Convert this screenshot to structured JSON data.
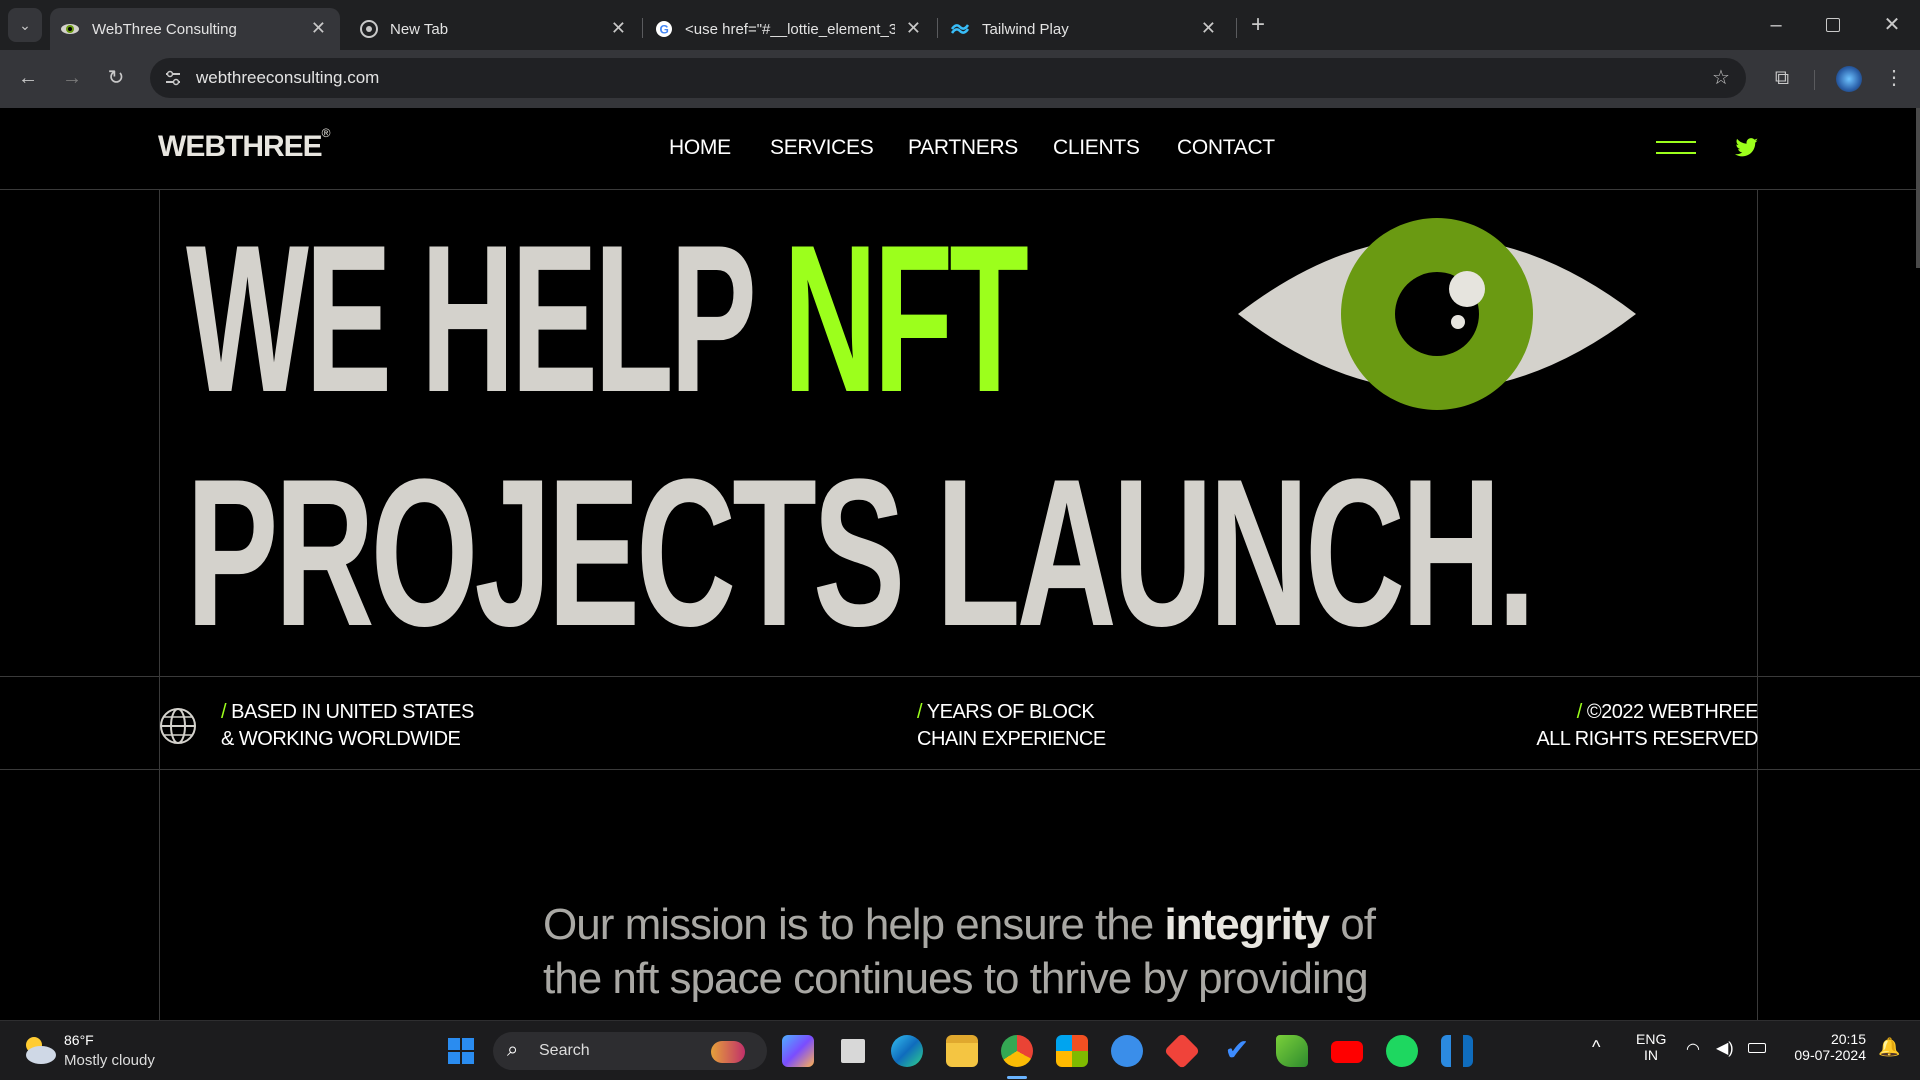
{
  "browser": {
    "tabs": [
      {
        "title": "WebThree Consulting",
        "active": true
      },
      {
        "title": "New Tab",
        "active": false
      },
      {
        "title": "<use href=\"#__lottie_element_3",
        "active": false
      },
      {
        "title": "Tailwind Play",
        "active": false
      }
    ],
    "url": "webthreeconsulting.com"
  },
  "site": {
    "logo": "WEBTHREE",
    "logo_mark": "®",
    "nav": [
      "HOME",
      "SERVICES",
      "PARTNERS",
      "CLIENTS",
      "CONTACT"
    ],
    "hero": {
      "line1_a": "WE HELP ",
      "line1_b": "NFT",
      "line2": "PROJECTS LAUNCH."
    },
    "info": {
      "left_1": "BASED IN UNITED STATES",
      "left_2": "& WORKING WORLDWIDE",
      "mid_1": "YEARS OF BLOCK",
      "mid_2": "CHAIN EXPERIENCE",
      "right_1": "©2022 WEBTHREE",
      "right_2": "ALL RIGHTS RESERVED",
      "slash": "/"
    },
    "mission": {
      "part1": "Our mission is to help ensure the ",
      "bold1": "integrity",
      "part2": " of the nft space continues to thrive by providing"
    },
    "colors": {
      "accent": "#9cff1c",
      "eye_iris": "#6a9a12",
      "hero_text": "#d4d2cc"
    }
  },
  "taskbar": {
    "weather_temp": "86°F",
    "weather_desc": "Mostly cloudy",
    "search_label": "Search",
    "lang_1": "ENG",
    "lang_2": "IN",
    "time": "20:15",
    "date": "09-07-2024"
  }
}
